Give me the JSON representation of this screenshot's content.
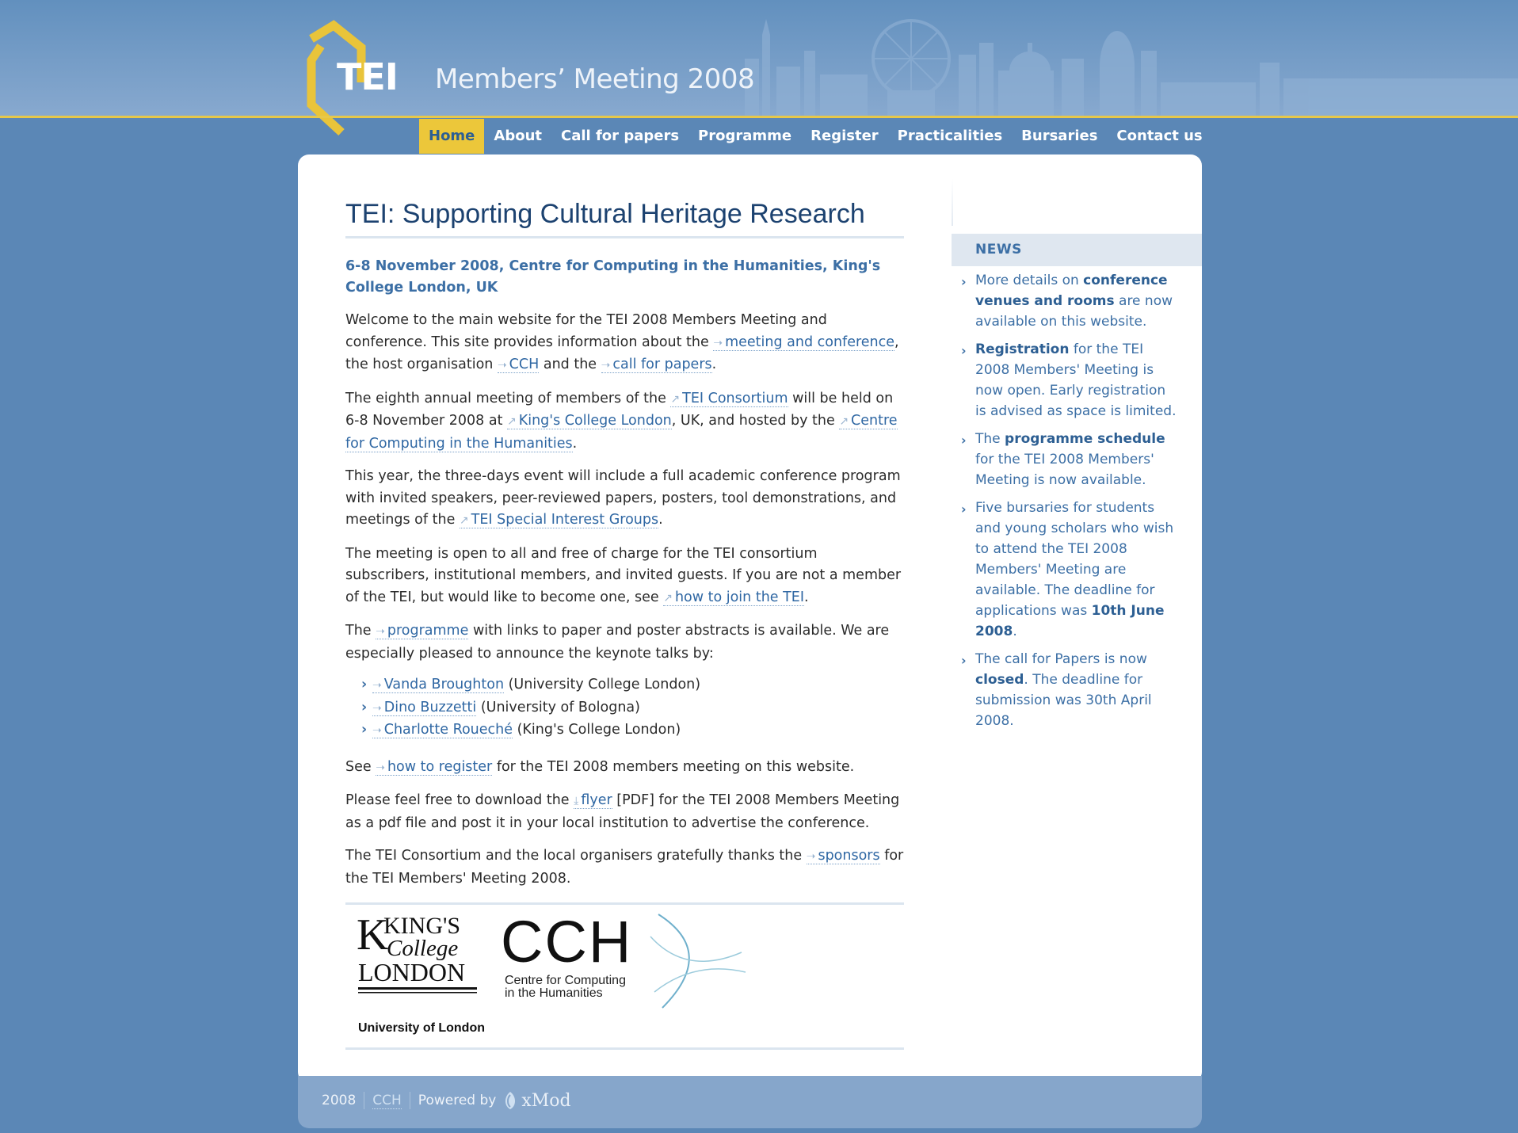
{
  "header": {
    "logo_text": "TEI",
    "site_title": "Members’ Meeting 2008"
  },
  "nav": {
    "items": [
      {
        "label": "Home",
        "active": true
      },
      {
        "label": "About"
      },
      {
        "label": "Call for papers"
      },
      {
        "label": "Programme"
      },
      {
        "label": "Register"
      },
      {
        "label": "Practicalities"
      },
      {
        "label": "Bursaries"
      },
      {
        "label": "Contact us"
      }
    ]
  },
  "main": {
    "title": "TEI: Supporting Cultural Heritage Research",
    "subtitle": "6-8 November 2008, Centre for Computing in the Humanities, King's College London, UK",
    "p1": {
      "a": "Welcome to the main website for the TEI 2008 Members Meeting and conference. This site provides information about the ",
      "link1": "meeting and conference",
      "b": ", the host organisation ",
      "link2": "CCH",
      "c": " and the ",
      "link3": "call for papers",
      "d": "."
    },
    "p2": {
      "a": "The eighth annual meeting of members of the ",
      "link1": "TEI Consortium",
      "b": " will be held on 6-8 November 2008 at ",
      "link2": "King's College London",
      "c": ", UK, and hosted by the ",
      "link3": "Centre for Computing in the Humanities",
      "d": "."
    },
    "p3": {
      "a": "This year, the three-days event will include a full academic conference program with invited speakers, peer-reviewed papers, posters, tool demonstrations, and meetings of the ",
      "link1": "TEI Special Interest Groups",
      "b": "."
    },
    "p4": {
      "a": "The meeting is open to all and free of charge for the TEI consortium subscribers, institutional members, and invited guests. If you are not a member of the TEI, but would like to become one, see ",
      "link1": "how to join the TEI",
      "b": "."
    },
    "p5": {
      "a": "The ",
      "link1": "programme",
      "b": " with links to paper and poster abstracts is available. We are especially pleased to announce the keynote talks by:"
    },
    "keynotes": [
      {
        "name": "Vanda Broughton",
        "affil": " (University College London)"
      },
      {
        "name": "Dino Buzzetti",
        "affil": " (University of Bologna)"
      },
      {
        "name": "Charlotte Roueché",
        "affil": " (King's College London)"
      }
    ],
    "p6": {
      "a": "See ",
      "link1": "how to register",
      "b": " for the TEI 2008 members meeting on this website."
    },
    "p7": {
      "a": "Please feel free to download the ",
      "link1": "flyer",
      "b": " [PDF] for the TEI 2008 Members Meeting as a pdf file and post it in your local institution to advertise the conference."
    },
    "p8": {
      "a": "The TEI Consortium and the local organisers gratefully thanks the ",
      "link1": "sponsors",
      "b": " for the TEI Members' Meeting 2008."
    },
    "sponsors": {
      "kings_line1": "KING'S",
      "kings_line2": "College",
      "kings_line3": "LONDON",
      "kings_sub": "University of London",
      "cch_big": "CCH",
      "cch_line1": "Centre for Computing",
      "cch_line2": "in the Humanities"
    }
  },
  "sidebar": {
    "news_title": "NEWS",
    "items": [
      {
        "a": "More details on ",
        "b": "conference venues and rooms",
        "c": " are now available on this website."
      },
      {
        "a": "",
        "b": "Registration",
        "c": " for the TEI 2008 Members' Meeting is now open. Early registration is advised as space is limited."
      },
      {
        "a": "The ",
        "b": "programme schedule",
        "c": " for the TEI 2008 Members' Meeting is now available."
      },
      {
        "a": "Five bursaries for students and young scholars who wish to attend the TEI 2008 Members' Meeting are available. The deadline for applications was ",
        "b": "10th June 2008",
        "c": "."
      },
      {
        "a": "The call for Papers is now ",
        "b": "closed",
        "c": ". The deadline for submission was 30th April 2008."
      }
    ]
  },
  "footer": {
    "year": "2008",
    "cch": "CCH",
    "powered_by": "Powered by",
    "xmod": "xMod"
  },
  "colors": {
    "background": "#5b87b6",
    "accent_yellow": "#ecc73a",
    "link_blue": "#2f67a3",
    "title_navy": "#1c4270"
  }
}
